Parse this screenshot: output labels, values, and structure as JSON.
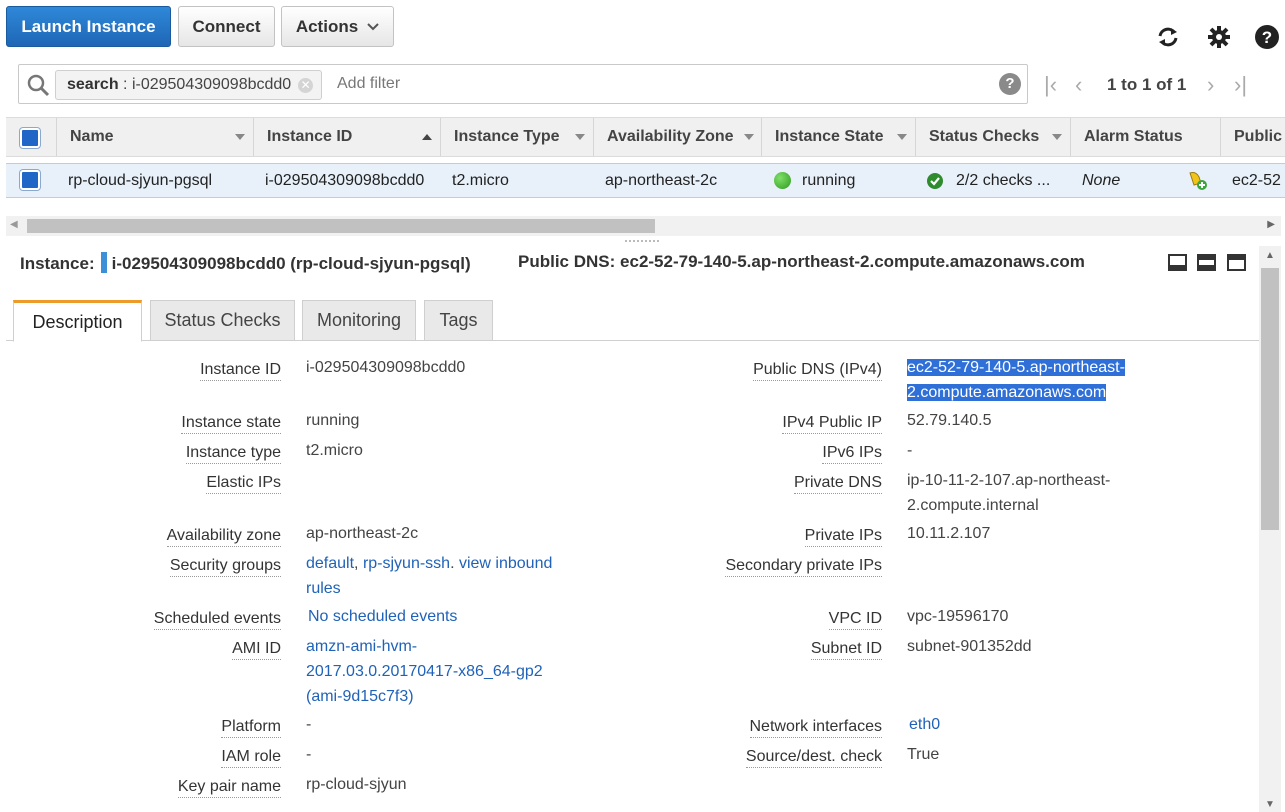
{
  "toolbar": {
    "launch_label": "Launch Instance",
    "connect_label": "Connect",
    "actions_label": "Actions",
    "icons": [
      "refresh-icon",
      "gear-icon",
      "help-icon"
    ]
  },
  "search": {
    "chip_key": "search",
    "chip_value": "i-029504309098bcdd0",
    "placeholder": "Add filter",
    "pager_text": "1 to 1 of 1"
  },
  "table": {
    "columns": [
      "Name",
      "Instance ID",
      "Instance Type",
      "Availability Zone",
      "Instance State",
      "Status Checks",
      "Alarm Status",
      "Public"
    ],
    "row": {
      "name": "rp-cloud-sjyun-pgsql",
      "instance_id": "i-029504309098bcdd0",
      "instance_type": "t2.micro",
      "zone": "ap-northeast-2c",
      "state": "running",
      "status_checks": "2/2 checks ...",
      "alarm": "None",
      "public": "ec2-52"
    },
    "colors": {
      "running": "#3cb02c",
      "check": "#2e8b2e"
    }
  },
  "detail": {
    "instance_label": "Instance:",
    "instance_value": "i-029504309098bcdd0 (rp-cloud-sjyun-pgsql)",
    "dns_label": "Public DNS:",
    "dns_value": "ec2-52-79-140-5.ap-northeast-2.compute.amazonaws.com"
  },
  "tabs": [
    "Description",
    "Status Checks",
    "Monitoring",
    "Tags"
  ],
  "description": {
    "left": {
      "instance_id": {
        "label": "Instance ID",
        "value": "i-029504309098bcdd0"
      },
      "instance_state": {
        "label": "Instance state",
        "value": "running"
      },
      "instance_type": {
        "label": "Instance type",
        "value": "t2.micro"
      },
      "elastic_ips": {
        "label": "Elastic IPs",
        "value": ""
      },
      "availability_zone": {
        "label": "Availability zone",
        "value": "ap-northeast-2c"
      },
      "security_groups": {
        "label": "Security groups",
        "sg1": "default",
        "sg2": "rp-sjyun-ssh",
        "view1": "view inbound",
        "view2": "rules"
      },
      "scheduled_events": {
        "label": "Scheduled events",
        "value": "No scheduled events"
      },
      "ami_id": {
        "label": "AMI ID",
        "line1": "amzn-ami-hvm-",
        "line2": "2017.03.0.20170417-x86_64-gp2",
        "line3": "(ami-9d15c7f3)"
      },
      "platform": {
        "label": "Platform",
        "value": "-"
      },
      "iam_role": {
        "label": "IAM role",
        "value": "-"
      },
      "key_pair": {
        "label": "Key pair name",
        "value": "rp-cloud-sjyun"
      }
    },
    "right": {
      "public_dns": {
        "label": "Public DNS (IPv4)",
        "line1": "ec2-52-79-140-5.ap-northeast-",
        "line2": "2.compute.amazonaws.com"
      },
      "ipv4_public": {
        "label": "IPv4 Public IP",
        "value": "52.79.140.5"
      },
      "ipv6": {
        "label": "IPv6 IPs",
        "value": "-"
      },
      "private_dns": {
        "label": "Private DNS",
        "line1": "ip-10-11-2-107.ap-northeast-",
        "line2": "2.compute.internal"
      },
      "private_ips": {
        "label": "Private IPs",
        "value": "10.11.2.107"
      },
      "secondary_ips": {
        "label": "Secondary private IPs",
        "value": ""
      },
      "vpc": {
        "label": "VPC ID",
        "value": "vpc-19596170"
      },
      "subnet": {
        "label": "Subnet ID",
        "value": "subnet-901352dd"
      },
      "network_interfaces": {
        "label": "Network interfaces",
        "value": "eth0"
      },
      "source_dest": {
        "label": "Source/dest. check",
        "value": "True"
      }
    }
  }
}
